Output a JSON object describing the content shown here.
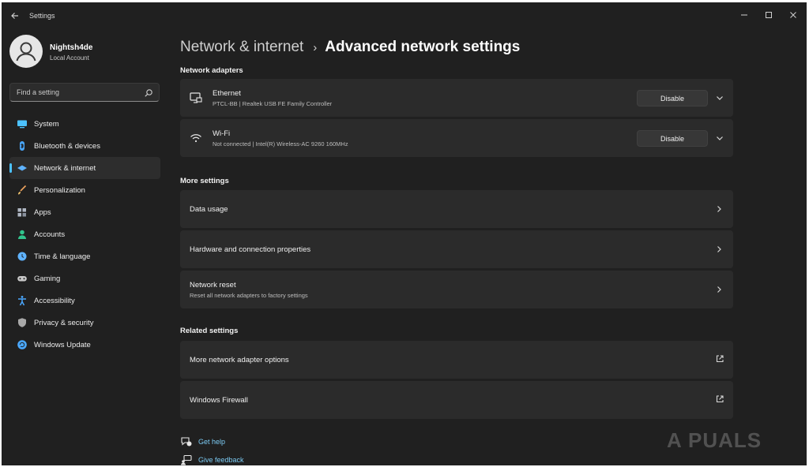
{
  "window": {
    "title": "Settings"
  },
  "profile": {
    "name": "Nightsh4de",
    "account_type": "Local Account"
  },
  "search": {
    "placeholder": "Find a setting",
    "icon": "search-icon"
  },
  "sidebar": {
    "items": [
      {
        "label": "System",
        "icon": "monitor-icon",
        "color": "#4cc2ff",
        "active": false
      },
      {
        "label": "Bluetooth & devices",
        "icon": "bluetooth-icon",
        "color": "#4aa8ff",
        "active": false
      },
      {
        "label": "Network & internet",
        "icon": "wifi-diamond-icon",
        "color": "#5fb3ff",
        "active": true
      },
      {
        "label": "Personalization",
        "icon": "brush-icon",
        "color": "#f0a35e",
        "active": false
      },
      {
        "label": "Apps",
        "icon": "apps-icon",
        "color": "#b0b7c3",
        "active": false
      },
      {
        "label": "Accounts",
        "icon": "person-icon",
        "color": "#31c48d",
        "active": false
      },
      {
        "label": "Time & language",
        "icon": "globe-clock-icon",
        "color": "#5fb3ff",
        "active": false
      },
      {
        "label": "Gaming",
        "icon": "gamepad-icon",
        "color": "#c8c8c8",
        "active": false
      },
      {
        "label": "Accessibility",
        "icon": "accessibility-icon",
        "color": "#4aa8ff",
        "active": false
      },
      {
        "label": "Privacy & security",
        "icon": "shield-icon",
        "color": "#a9a9a9",
        "active": false
      },
      {
        "label": "Windows Update",
        "icon": "update-icon",
        "color": "#4aa8ff",
        "active": false
      }
    ]
  },
  "breadcrumb": {
    "parent": "Network & internet",
    "separator": "›",
    "current": "Advanced network settings"
  },
  "sections": {
    "network_adapters": "Network adapters",
    "more_settings": "More settings",
    "related_settings": "Related settings"
  },
  "adapters": [
    {
      "name": "Ethernet",
      "description": "PTCL-BB | Realtek USB FE Family Controller",
      "button": "Disable",
      "icon": "ethernet-icon"
    },
    {
      "name": "Wi-Fi",
      "description": "Not connected | Intel(R) Wireless-AC 9260 160MHz",
      "button": "Disable",
      "icon": "wifi-icon"
    }
  ],
  "more_settings": [
    {
      "title": "Data usage",
      "subtitle": ""
    },
    {
      "title": "Hardware and connection properties",
      "subtitle": ""
    },
    {
      "title": "Network reset",
      "subtitle": "Reset all network adapters to factory settings"
    }
  ],
  "related_settings": [
    {
      "title": "More network adapter options"
    },
    {
      "title": "Windows Firewall"
    }
  ],
  "footer": {
    "get_help": "Get help",
    "give_feedback": "Give feedback"
  },
  "watermark": {
    "text": "A PUALS"
  },
  "colors": {
    "accent": "#4cc2ff",
    "link": "#7ccbf4",
    "background": "#202020",
    "card": "#2b2b2b"
  }
}
